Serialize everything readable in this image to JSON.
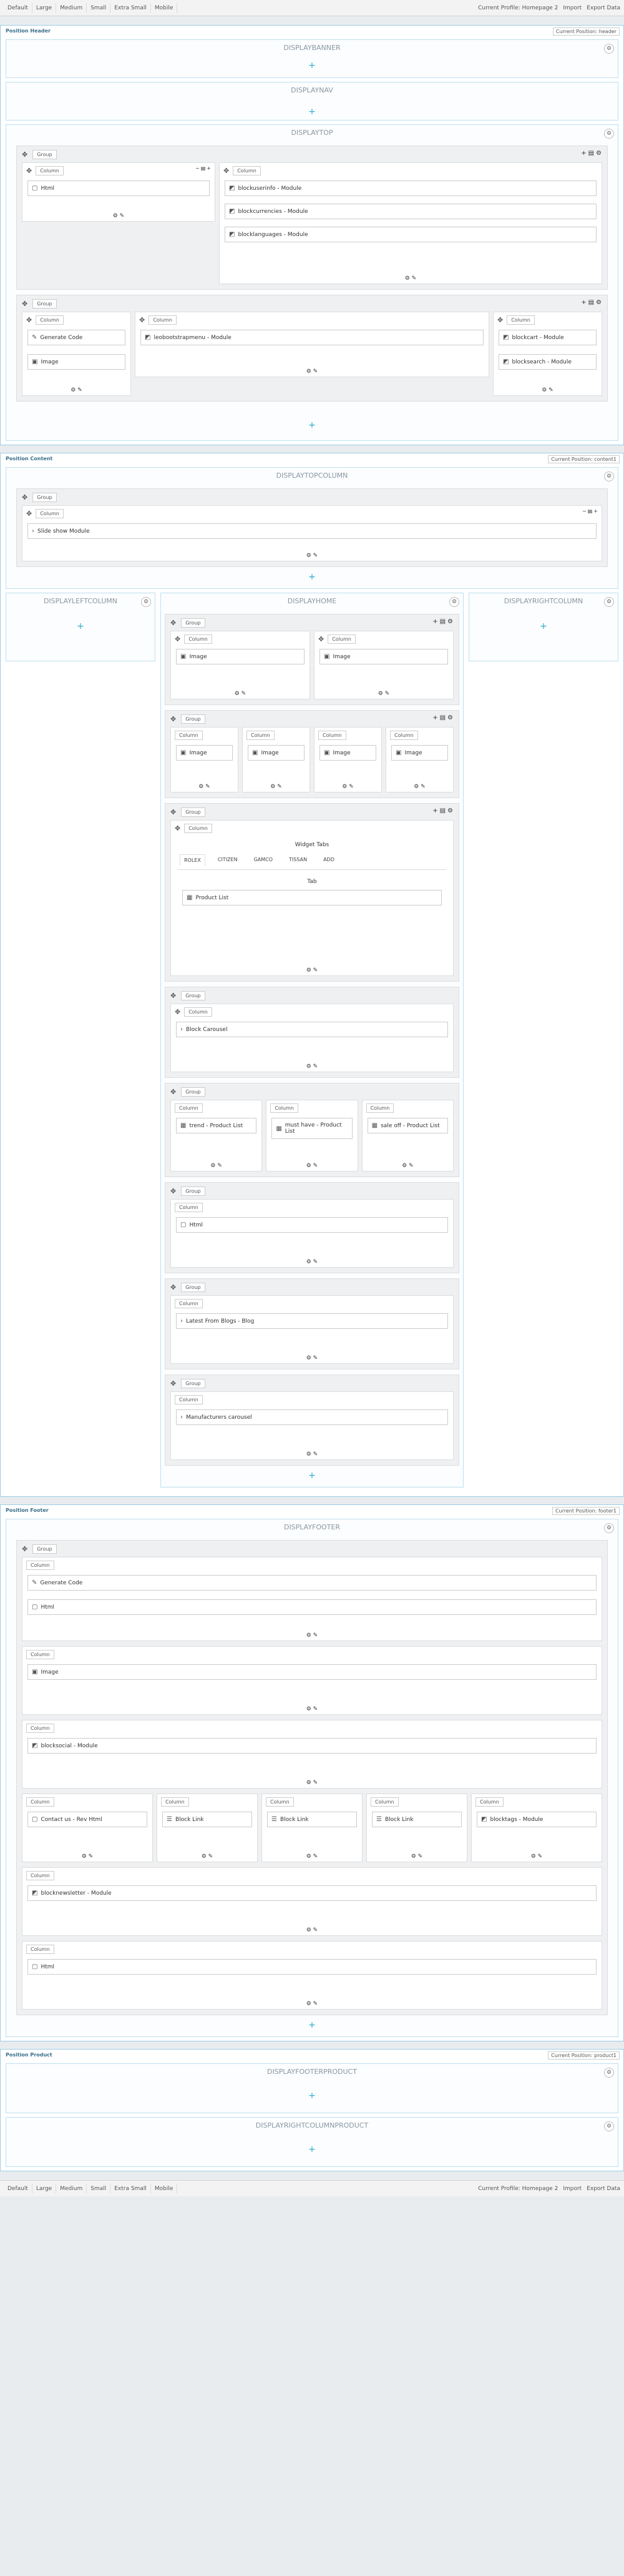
{
  "toolbar": {
    "devices": [
      "Default",
      "Large",
      "Medium",
      "Small",
      "Extra Small",
      "Mobile"
    ],
    "profile": "Current Profile: Homepage 2",
    "import": "Import",
    "export": "Export Data"
  },
  "header": {
    "title": "Position Header",
    "profile": "Current Position: header"
  },
  "content": {
    "title": "Position Content",
    "profile": "Current Position: content1"
  },
  "footer": {
    "title": "Position Footer",
    "profile": "Current Position: footer1"
  },
  "product": {
    "title": "Position Product",
    "profile": "Current Position: product1"
  },
  "hooks": {
    "banner": "DISPLAYBANNER",
    "nav": "DISPLAYNAV",
    "top": "DISPLAYTOP",
    "topcolumn": "DISPLAYTOPCOLUMN",
    "left": "DISPLAYLEFTCOLUMN",
    "home": "DISPLAYHOME",
    "right": "DISPLAYRIGHTCOLUMN",
    "foot": "DISPLAYFOOTER",
    "footprod": "DISPLAYFOOTERPRODUCT",
    "rightprod": "DISPLAYRIGHTCOLUMNPRODUCT"
  },
  "labels": {
    "group": "Group",
    "column": "Column"
  },
  "modules": {
    "html": "Html",
    "userinfo": "blockuserinfo - Module",
    "currencies": "blockcurrencies - Module",
    "languages": "blocklanguages - Module",
    "gencode": "Generate Code",
    "image": "Image",
    "topmenu": "leobootstrapmenu - Module",
    "cart": "blockcart - Module",
    "search": "blocksearch - Module",
    "slideshow": "Slide show Module",
    "productlist": "Product List",
    "blockcarousel": "Block Carousel",
    "trend": "trend - Product List",
    "musthave": "must have - Product List",
    "saleoff": "sale off - Product List",
    "html2": "Html",
    "blogs": "Latest From Blogs - Blog",
    "manufacturers": "Manufacturers carousel",
    "social": "blocksocial - Module",
    "contact": "Contact us - Rev Html",
    "blocklink": "Block Link",
    "tags": "blocktags - Module",
    "newsletter": "blocknewsletter - Module"
  },
  "widgettabs": {
    "title": "Widget Tabs",
    "tabs": [
      "ROLEX",
      "CITIZEN",
      "GAMCO",
      "TISSAN"
    ],
    "add": "ADD",
    "tab": "Tab"
  }
}
